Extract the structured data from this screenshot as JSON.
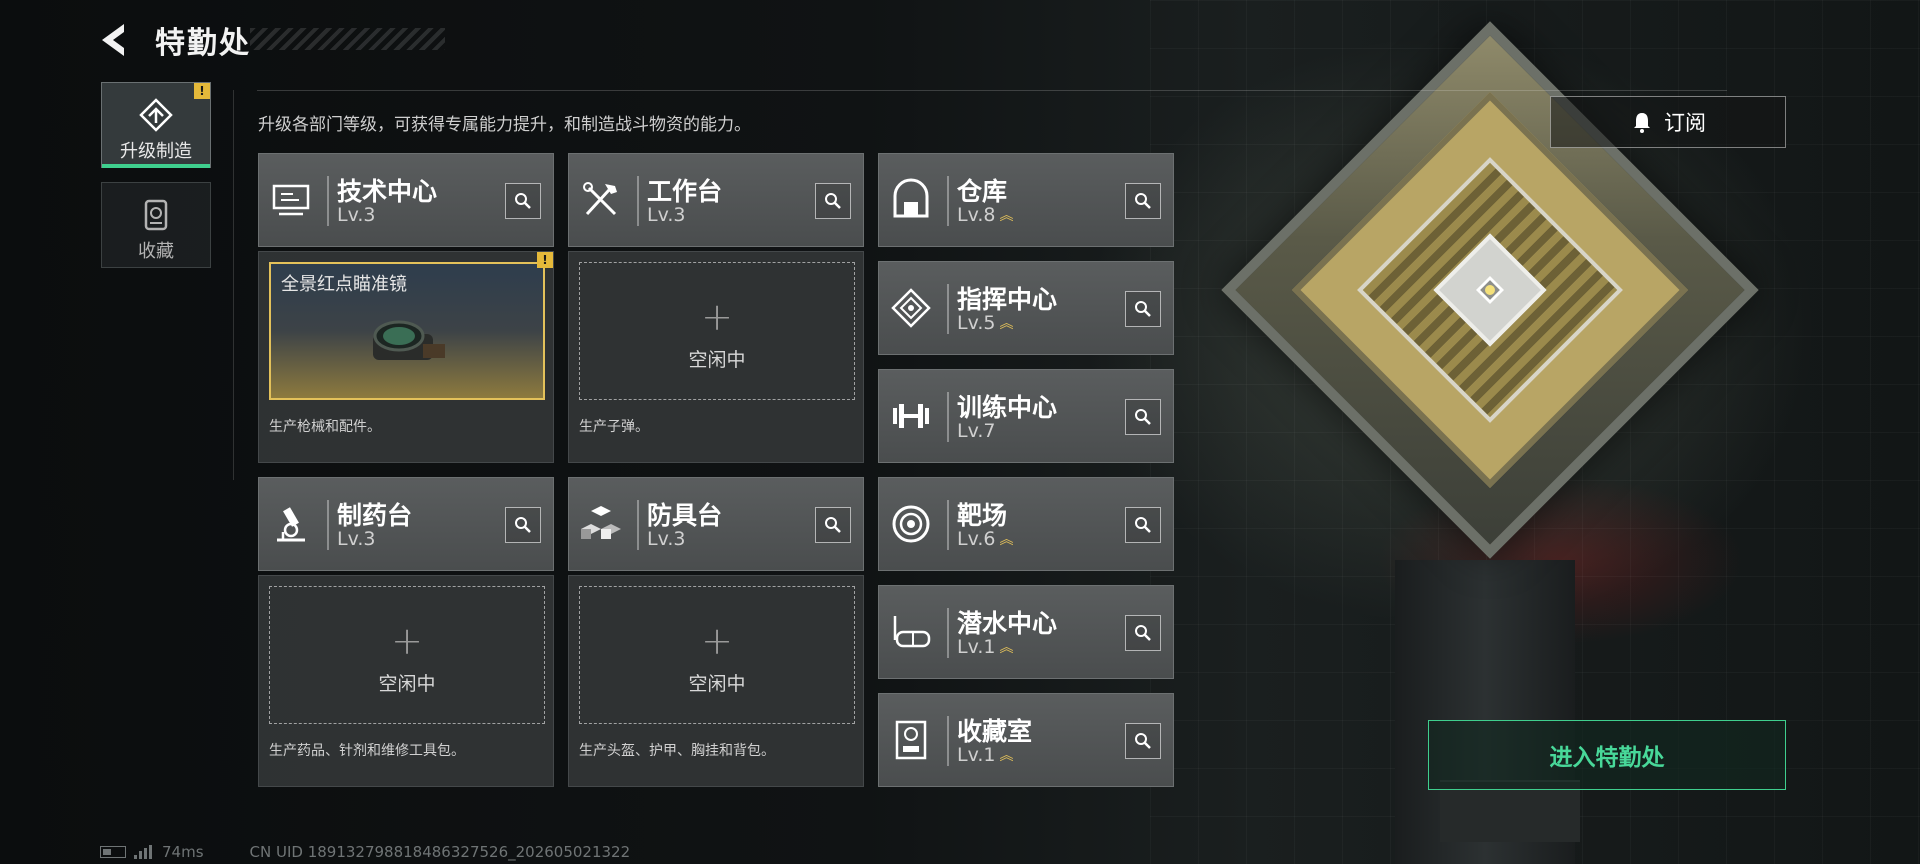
{
  "header": {
    "title": "特勤处"
  },
  "nav": [
    {
      "label": "升级制造",
      "icon": "upgrade-icon",
      "active": true,
      "alert": "!"
    },
    {
      "label": "收藏",
      "icon": "collection-icon",
      "active": false
    }
  ],
  "description": "升级各部门等级，可获得专属能力提升，和制造战斗物资的能力。",
  "subscribe": {
    "label": "订阅",
    "icon": "bell-icon"
  },
  "departments": [
    {
      "name": "技术中心",
      "level": "Lv.3",
      "icon": "computer-icon",
      "upgradable": false
    },
    {
      "name": "工作台",
      "level": "Lv.3",
      "icon": "tools-icon",
      "upgradable": false
    },
    {
      "name": "仓库",
      "level": "Lv.8",
      "icon": "warehouse-icon",
      "upgradable": true
    },
    {
      "name": "指挥中心",
      "level": "Lv.5",
      "icon": "command-icon",
      "upgradable": true
    },
    {
      "name": "训练中心",
      "level": "Lv.7",
      "icon": "dumbbell-icon",
      "upgradable": false
    },
    {
      "name": "制药台",
      "level": "Lv.3",
      "icon": "microscope-icon",
      "upgradable": false
    },
    {
      "name": "防具台",
      "level": "Lv.3",
      "icon": "cubes-icon",
      "upgradable": false
    },
    {
      "name": "靶场",
      "level": "Lv.6",
      "icon": "target-icon",
      "upgradable": true
    },
    {
      "name": "潜水中心",
      "level": "Lv.1",
      "icon": "diving-mask-icon",
      "upgradable": true
    },
    {
      "name": "收藏室",
      "level": "Lv.1",
      "icon": "collection-room-icon",
      "upgradable": true
    }
  ],
  "production": [
    {
      "item": "全景红点瞄准镜",
      "status": "",
      "desc": "生产枪械和配件。",
      "alert": "!"
    },
    {
      "item": "",
      "status": "空闲中",
      "desc": "生产子弹。"
    },
    {
      "item": "",
      "status": "空闲中",
      "desc": "生产药品、针剂和维修工具包。"
    },
    {
      "item": "",
      "status": "空闲中",
      "desc": "生产头盔、护甲、胸挂和背包。"
    }
  ],
  "enter_button": "进入特勤处",
  "status_bar": {
    "latency": "74ms",
    "uid": "CN UID 189132798818486327526_202605021322"
  },
  "colors": {
    "accent_green": "#3fcf8e",
    "alert_yellow": "#e5b93a",
    "upgrade_gold": "#e3c15a"
  }
}
